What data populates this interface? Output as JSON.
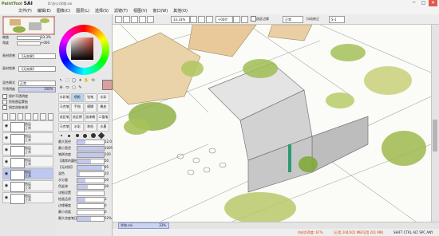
{
  "app": {
    "logo": "PaintTool",
    "logo_bold": "SAI",
    "doc_title": "D:\\办公\\学校.sai"
  },
  "menu": [
    "文件(F)",
    "编辑(E)",
    "图像(C)",
    "图层(L)",
    "选择(S)",
    "滤镜(T)",
    "视图(V)",
    "窗口(W)",
    "其他(O)"
  ],
  "window_buttons": [
    "─",
    "▢",
    "✕"
  ],
  "toolbar": {
    "zoom": "33.33%",
    "angle": "+000°",
    "blend": "正常",
    "stabilizer_label": "抖动修正",
    "stabilizer_value": "S-1",
    "select_edge_label": "选区边缘"
  },
  "navigator": {
    "zoom_label": "缩放",
    "zoom_value": "33.3%",
    "angle_label": "角度",
    "angle_value": "+000"
  },
  "layer_props": {
    "texture_label": "画材质感",
    "texture_value": "【无效果】",
    "effect_label": "画材效果",
    "effect_value": "【无效果】",
    "blend_label": "混合模式",
    "blend_value": "正常",
    "opacity_label": "不透明度",
    "opacity_value": "100%",
    "checks": [
      "保护不透明度",
      "剪贴图层蒙板",
      "指定选取来源"
    ]
  },
  "layers": [
    {
      "name": "图层",
      "mode": "正常"
    },
    {
      "name": "图层",
      "mode": "正常"
    },
    {
      "name": "图层",
      "mode": "正常"
    },
    {
      "name": "图层",
      "mode": "正常"
    },
    {
      "name": "图层",
      "mode": "正常",
      "selected": true
    },
    {
      "name": "图层",
      "mode": "正常"
    },
    {
      "name": "图层",
      "mode": "正常"
    }
  ],
  "tools": [
    "↖",
    "⬚",
    "◯",
    "✦",
    "✋",
    "⟲",
    "⊕",
    "⬭",
    "▢",
    "✎"
  ],
  "brushes": [
    {
      "name": "水彩笔"
    },
    {
      "name": "喷枪"
    },
    {
      "name": "铅笔"
    },
    {
      "name": "水彩"
    },
    {
      "name": "马克笔"
    },
    {
      "name": "手指"
    },
    {
      "name": "模糊"
    },
    {
      "name": "橡皮"
    },
    {
      "name": "选区笔"
    },
    {
      "name": "选区擦"
    },
    {
      "name": "油漆桶"
    },
    {
      "name": "二值笔"
    },
    {
      "name": "马克笔"
    },
    {
      "name": "水彩"
    },
    {
      "name": "和纸"
    },
    {
      "name": "水墨"
    }
  ],
  "brush_params": [
    {
      "label": "最大直径",
      "value": "12.0"
    },
    {
      "label": "最小直径",
      "value": "100%"
    },
    {
      "label": "笔刷浓度",
      "value": "100"
    },
    {
      "label": "【通常的圆形】",
      "value": "50"
    },
    {
      "label": "【无材质】",
      "value": "95"
    },
    {
      "label": "混色",
      "value": "10"
    },
    {
      "label": "水分量",
      "value": "30"
    },
    {
      "label": "色延伸",
      "value": "39"
    },
    {
      "label": "详细设置",
      "value": ""
    },
    {
      "label": "绘画品质",
      "value": "3"
    },
    {
      "label": "边缘硬度",
      "value": "0"
    },
    {
      "label": "最小浓度",
      "value": "0"
    },
    {
      "label": "最大浓度笔压",
      "value": "52%"
    }
  ],
  "brush_param_fill": [
    0.3,
    1.0,
    1.0,
    0.5,
    0.95,
    0.1,
    0.3,
    0.39,
    0,
    0.3,
    0.0,
    0.0,
    0.52
  ],
  "doc_tab": {
    "name": "学校.sai",
    "zoom": "33%"
  },
  "status": {
    "memory": "内存负荷度: 67%",
    "usage": "(已用 204/301 MB/可用 201 MB)",
    "keys": "SHIFT CTRL ALT SPC ANY"
  }
}
